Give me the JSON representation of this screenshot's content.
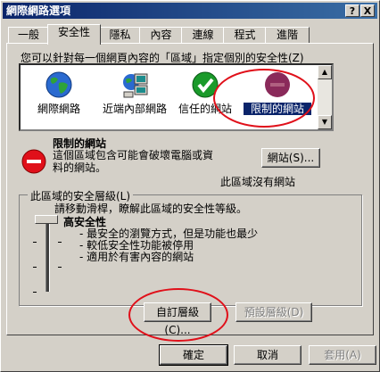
{
  "window": {
    "title": "網際網路選項",
    "help_btn": "?",
    "close_btn": "X"
  },
  "tabs": [
    {
      "label": "一般"
    },
    {
      "label": "安全性"
    },
    {
      "label": "隱私"
    },
    {
      "label": "內容"
    },
    {
      "label": "連線"
    },
    {
      "label": "程式"
    },
    {
      "label": "進階"
    }
  ],
  "security": {
    "intro": "您可以針對每一個網頁內容的「區域」指定個別的安全性(Z)",
    "zones": [
      {
        "label": "網際網路",
        "icon": "globe-icon"
      },
      {
        "label": "近端內部網路",
        "icon": "local-intranet-icon"
      },
      {
        "label": "信任的網站",
        "icon": "trusted-sites-icon"
      },
      {
        "label": "限制的網站",
        "icon": "restricted-sites-icon"
      }
    ],
    "selected_zone_title": "限制的網站",
    "selected_zone_desc": "這個區域包含可能會破壞電腦或資料的網站。",
    "sites_button": "網站(S)...",
    "no_sites_text": "此區域沒有網站",
    "group_title": "此區域的安全層級(L)",
    "slider_hint": "請移動滑桿，瞭解此區域的安全性等級。",
    "level_name": "高安全性",
    "level_bullets": [
      "- 最安全的瀏覽方式，但是功能也最少",
      "- 較低安全性功能被停用",
      "- 適用於有害內容的網站"
    ],
    "custom_level_button": "自訂層級(C)...",
    "default_level_button": "預設層級(D)"
  },
  "footer": {
    "ok": "確定",
    "cancel": "取消",
    "apply": "套用(A)"
  },
  "colors": {
    "titlebar_start": "#0a246a",
    "titlebar_end": "#3a6ea5",
    "annotation_red": "#e0101a",
    "selection_blue": "#0a246a"
  }
}
